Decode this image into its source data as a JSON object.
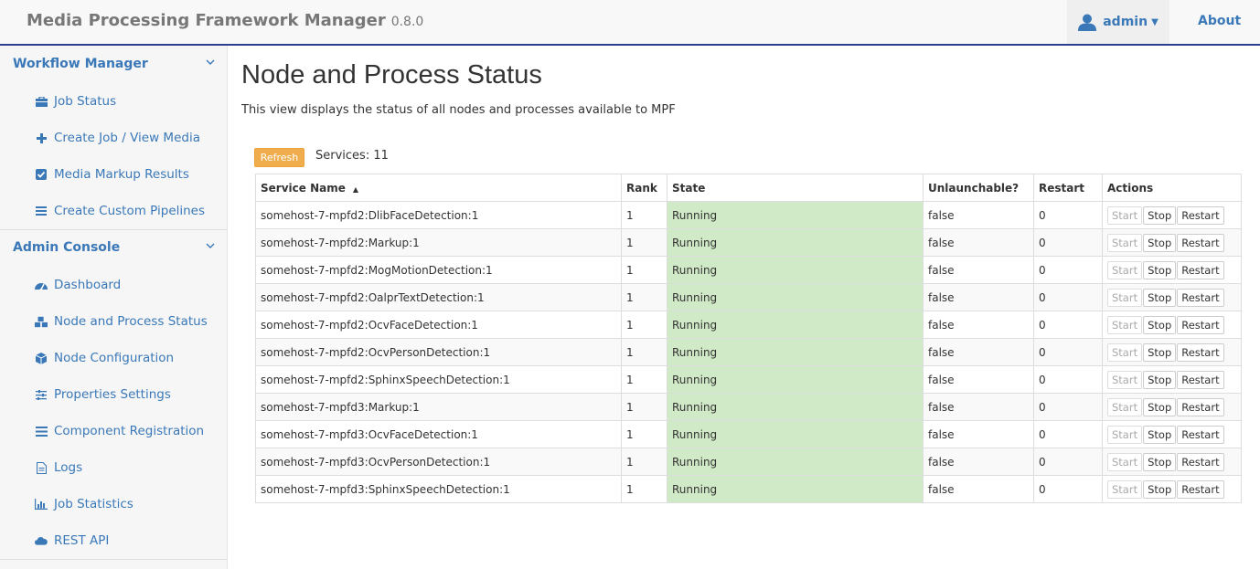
{
  "header": {
    "app_title": "Media Processing Framework Manager",
    "version": "0.8.0",
    "user": "admin",
    "about": "About"
  },
  "sidebar": {
    "workflow_manager": {
      "label": "Workflow Manager",
      "items": [
        {
          "label": "Job Status",
          "icon": "briefcase-icon"
        },
        {
          "label": "Create Job / View Media",
          "icon": "plus-icon"
        },
        {
          "label": "Media Markup Results",
          "icon": "check-square-icon"
        },
        {
          "label": "Create Custom Pipelines",
          "icon": "list-icon"
        }
      ]
    },
    "admin_console": {
      "label": "Admin Console",
      "items": [
        {
          "label": "Dashboard",
          "icon": "dashboard-icon"
        },
        {
          "label": "Node and Process Status",
          "icon": "cubes-icon"
        },
        {
          "label": "Node Configuration",
          "icon": "cube-icon"
        },
        {
          "label": "Properties Settings",
          "icon": "sliders-icon"
        },
        {
          "label": "Component Registration",
          "icon": "bars-icon"
        },
        {
          "label": "Logs",
          "icon": "file-text-icon"
        },
        {
          "label": "Job Statistics",
          "icon": "bar-chart-icon"
        },
        {
          "label": "REST API",
          "icon": "cloud-icon"
        }
      ]
    }
  },
  "main": {
    "title": "Node and Process Status",
    "description": "This view displays the status of all nodes and processes available to MPF",
    "refresh_label": "Refresh",
    "services_count": "Services: 11",
    "columns": [
      "Service Name",
      "Rank",
      "State",
      "Unlaunchable?",
      "Restart",
      "Actions"
    ],
    "action_labels": {
      "start": "Start",
      "stop": "Stop",
      "restart": "Restart"
    },
    "rows": [
      {
        "name": "somehost-7-mpfd2:DlibFaceDetection:1",
        "rank": "1",
        "state": "Running",
        "unlaunchable": "false",
        "restart": "0"
      },
      {
        "name": "somehost-7-mpfd2:Markup:1",
        "rank": "1",
        "state": "Running",
        "unlaunchable": "false",
        "restart": "0"
      },
      {
        "name": "somehost-7-mpfd2:MogMotionDetection:1",
        "rank": "1",
        "state": "Running",
        "unlaunchable": "false",
        "restart": "0"
      },
      {
        "name": "somehost-7-mpfd2:OalprTextDetection:1",
        "rank": "1",
        "state": "Running",
        "unlaunchable": "false",
        "restart": "0"
      },
      {
        "name": "somehost-7-mpfd2:OcvFaceDetection:1",
        "rank": "1",
        "state": "Running",
        "unlaunchable": "false",
        "restart": "0"
      },
      {
        "name": "somehost-7-mpfd2:OcvPersonDetection:1",
        "rank": "1",
        "state": "Running",
        "unlaunchable": "false",
        "restart": "0"
      },
      {
        "name": "somehost-7-mpfd2:SphinxSpeechDetection:1",
        "rank": "1",
        "state": "Running",
        "unlaunchable": "false",
        "restart": "0"
      },
      {
        "name": "somehost-7-mpfd3:Markup:1",
        "rank": "1",
        "state": "Running",
        "unlaunchable": "false",
        "restart": "0"
      },
      {
        "name": "somehost-7-mpfd3:OcvFaceDetection:1",
        "rank": "1",
        "state": "Running",
        "unlaunchable": "false",
        "restart": "0"
      },
      {
        "name": "somehost-7-mpfd3:OcvPersonDetection:1",
        "rank": "1",
        "state": "Running",
        "unlaunchable": "false",
        "restart": "0"
      },
      {
        "name": "somehost-7-mpfd3:SphinxSpeechDetection:1",
        "rank": "1",
        "state": "Running",
        "unlaunchable": "false",
        "restart": "0"
      }
    ]
  },
  "colors": {
    "link": "#3a78b8",
    "refresh": "#f0ad4e",
    "running": "#d0e9c6",
    "navbar_border": "#2c3e8f"
  }
}
